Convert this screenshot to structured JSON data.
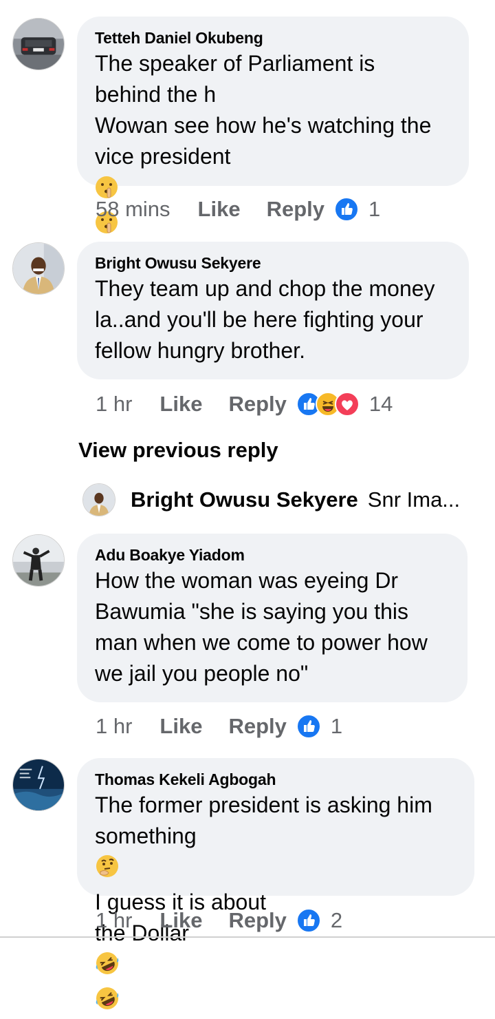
{
  "comments": [
    {
      "author": "Tetteh Daniel Okubeng",
      "text_lines": [
        "The speaker of Parliament is",
        "behind the h",
        "Wowan see how he's watching the",
        "vice president"
      ],
      "emoji_icon": "shushing-face-icon",
      "time": "58 mins",
      "like_label": "Like",
      "reply_label": "Reply",
      "reaction_count": "1"
    },
    {
      "author": "Bright Owusu Sekyere",
      "text_lines": [
        "They team up and chop the money",
        "la..and you'll be here fighting your",
        "fellow hungry brother."
      ],
      "time": "1 hr",
      "like_label": "Like",
      "reply_label": "Reply",
      "reaction_count": "14"
    },
    {
      "author": "Adu Boakye Yiadom",
      "text_lines": [
        "How the woman was eyeing Dr",
        "Bawumia \"she is saying you this",
        "man when we come to power how",
        "we jail you people no\""
      ],
      "time": "1 hr",
      "like_label": "Like",
      "reply_label": "Reply",
      "reaction_count": "1"
    },
    {
      "author": "Thomas Kekeli Agbogah",
      "text_line1": "The former president is asking him",
      "text_line2a": "something",
      "text_line2b": "I guess it is about",
      "text_line3": "the Dollar",
      "time": "1 hr",
      "like_label": "Like",
      "reply_label": "Reply",
      "reaction_count": "2"
    }
  ],
  "view_previous": "View previous reply",
  "reply_preview": {
    "author": "Bright Owusu Sekyere",
    "text": "Snr Ima..."
  },
  "colors": {
    "bubble": "#f0f2f5",
    "meta_gray": "#65676b",
    "like_blue": "#1877f2",
    "love_red": "#f33e58",
    "haha_yellow": "#f7b928"
  }
}
